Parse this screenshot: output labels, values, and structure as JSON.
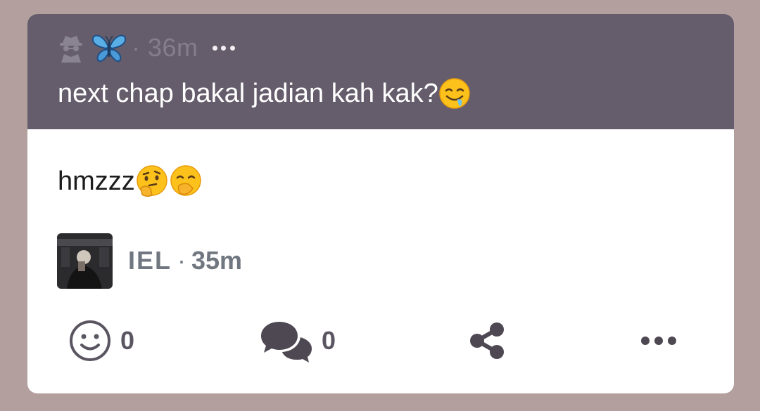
{
  "colors": {
    "background": "#b39f9d",
    "quote_background": "#655d6b",
    "card_background": "#ffffff",
    "meta_gray": "#707780",
    "icon_dark": "#5a5560"
  },
  "quoted_comment": {
    "author_icons": [
      "spy-icon",
      "butterfly-icon"
    ],
    "time": "· 36m",
    "more_icon": "more-horizontal-icon",
    "text": "next chap bakal jadian kah kak?",
    "emoji": "drooling-face-icon"
  },
  "reply": {
    "text": "hmzzz",
    "emojis": [
      "thinking-face-icon",
      "face-with-hand-over-mouth-icon"
    ]
  },
  "author": {
    "name": "IEL",
    "separator": "·",
    "time": "35m"
  },
  "actions": {
    "react": {
      "icon": "smiley-icon",
      "count": "0"
    },
    "reply": {
      "icon": "comments-icon",
      "count": "0"
    },
    "share": {
      "icon": "share-icon"
    },
    "more": {
      "icon": "more-horizontal-icon"
    }
  }
}
